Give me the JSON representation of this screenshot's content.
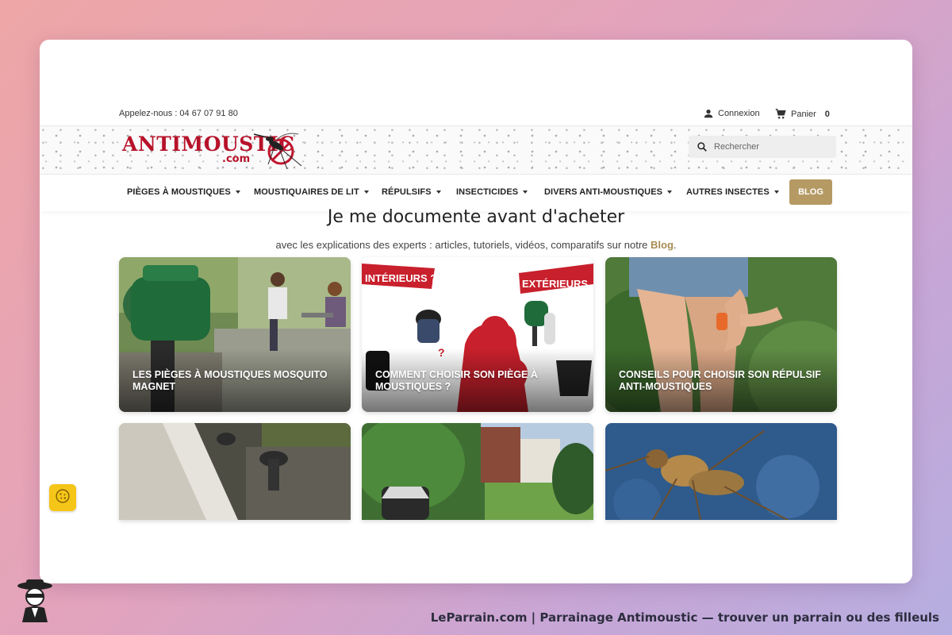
{
  "topbar": {
    "phone": "Appelez-nous : 04 67 07 91 80",
    "login_label": "Connexion",
    "cart_label": "Panier",
    "cart_count": "0"
  },
  "header": {
    "logo_text": "ANTIMOUSTIC",
    "logo_sub": ".com",
    "search_placeholder": "Rechercher"
  },
  "nav": {
    "items": [
      {
        "label": "PIÈGES À MOUSTIQUES"
      },
      {
        "label": "MOUSTIQUAIRES DE LIT"
      },
      {
        "label": "RÉPULSIFS"
      },
      {
        "label": "INSECTICIDES"
      },
      {
        "label": "DIVERS ANTI-MOUSTIQUES"
      },
      {
        "label": "AUTRES INSECTES"
      }
    ],
    "blog_label": "BLOG"
  },
  "section": {
    "title": "Je me documente avant d'acheter",
    "subtitle": "avec les explications des experts : articles, tutoriels, vidéos, comparatifs sur notre ",
    "blog_link": "Blog",
    "subtitle_end": "."
  },
  "cards": [
    {
      "title": "LES PIÈGES À MOUSTIQUES MOSQUITO MAGNET"
    },
    {
      "title": "COMMENT CHOISIR SON PIÈGE À MOUSTIQUES ?",
      "tag_left": "INTÉRIEURS ?",
      "tag_right": "EXTÉRIEURS"
    },
    {
      "title": "CONSEILS POUR CHOISIR SON RÉPULSIF ANTI-MOUSTIQUES"
    }
  ],
  "caption": "LeParrain.com | Parrainage Antimoustic — trouver un parrain ou des filleuls",
  "colors": {
    "accent": "#b59a64",
    "logo_red": "#b7122a",
    "cookie": "#f5c518"
  }
}
